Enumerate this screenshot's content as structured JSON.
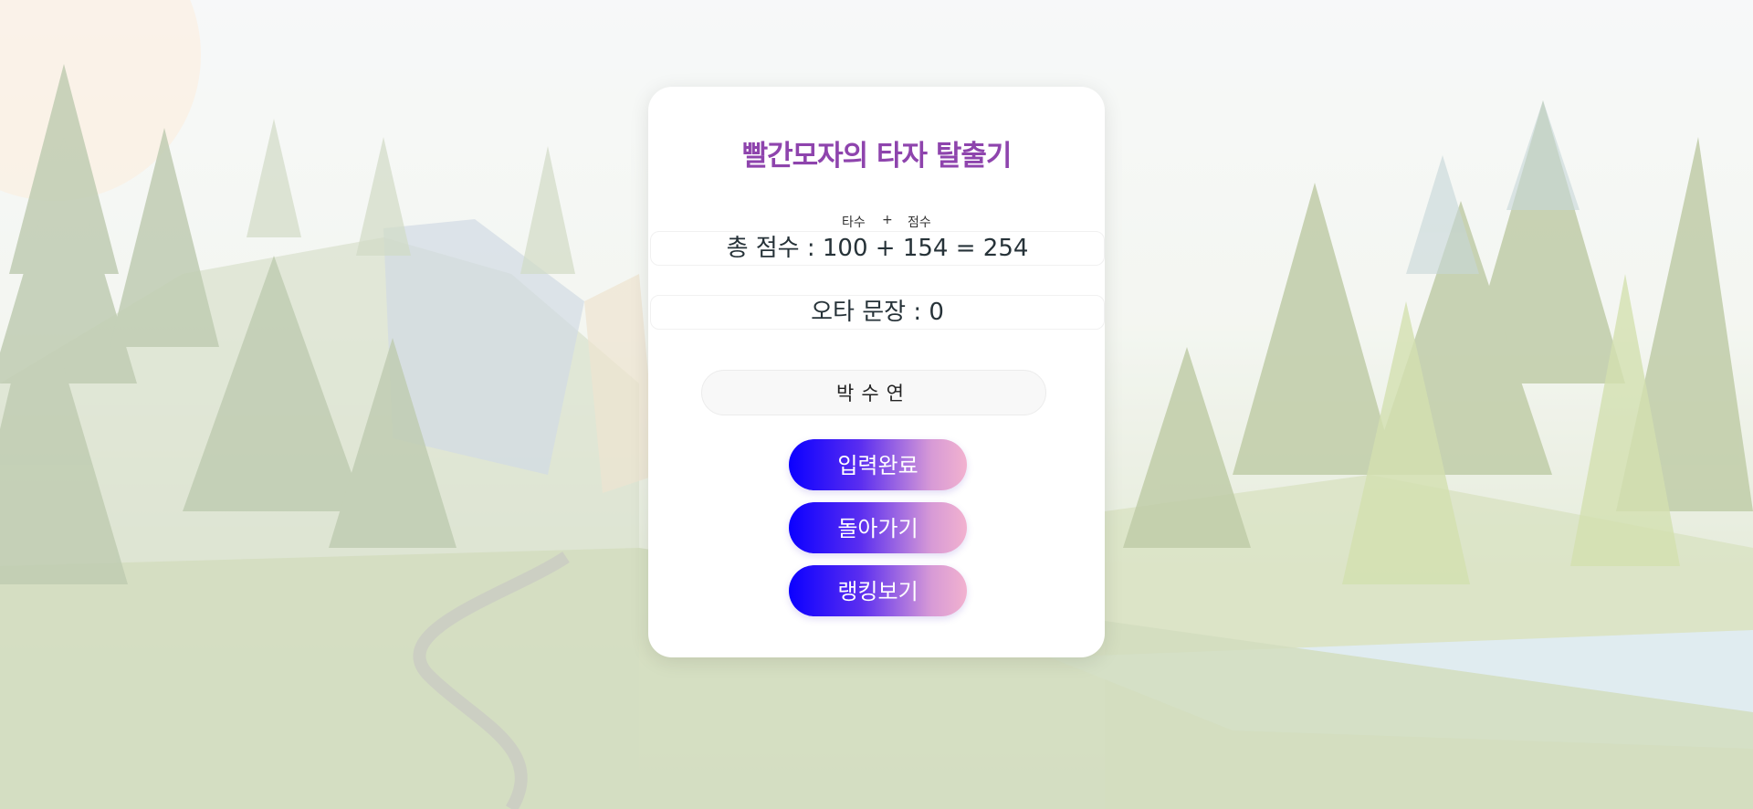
{
  "card": {
    "title": "빨간모자의 타자 탈출기",
    "hint_left": "타수",
    "hint_plus": "+",
    "hint_right": "점수",
    "total_score_text": "총 점수 : 100 + 154 = 254",
    "typo_text": "오타 문장 : 0",
    "name_value": "박수연"
  },
  "buttons": {
    "submit_label": "입력완료",
    "back_label": "돌아가기",
    "ranking_label": "랭킹보기"
  },
  "colors": {
    "title": "#8e44ad",
    "button_gradient_start": "#0b00ff",
    "button_gradient_end": "#f2b2cf"
  }
}
